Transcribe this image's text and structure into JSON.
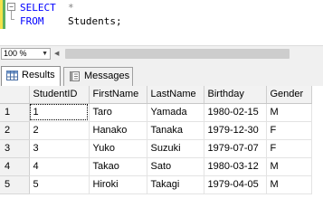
{
  "editor": {
    "fold_marker": "−",
    "lines": [
      {
        "keyword": "SELECT",
        "gap": "  ",
        "rest": "*"
      },
      {
        "keyword": "FROM",
        "gap": "    ",
        "rest": "Students;"
      }
    ]
  },
  "zoom": {
    "value": "100 %"
  },
  "tabs": [
    {
      "label": "Results",
      "icon": "grid-results-icon",
      "active": true
    },
    {
      "label": "Messages",
      "icon": "messages-icon",
      "active": false
    }
  ],
  "grid": {
    "columns": [
      "StudentID",
      "FirstName",
      "LastName",
      "Birthday",
      "Gender"
    ],
    "rows": [
      {
        "num": "1",
        "cells": [
          "1",
          "Taro",
          "Yamada",
          "1980-02-15",
          "M"
        ]
      },
      {
        "num": "2",
        "cells": [
          "2",
          "Hanako",
          "Tanaka",
          "1979-12-30",
          "F"
        ]
      },
      {
        "num": "3",
        "cells": [
          "3",
          "Yuko",
          "Suzuki",
          "1979-07-07",
          "F"
        ]
      },
      {
        "num": "4",
        "cells": [
          "4",
          "Takao",
          "Sato",
          "1980-03-12",
          "M"
        ]
      },
      {
        "num": "5",
        "cells": [
          "5",
          "Hiroki",
          "Takagi",
          "1979-04-05",
          "M"
        ]
      }
    ]
  },
  "colors": {
    "keyword": "#0000ff",
    "gutter_saved": "#5fb25f",
    "gutter_changed": "#f5e24a"
  }
}
